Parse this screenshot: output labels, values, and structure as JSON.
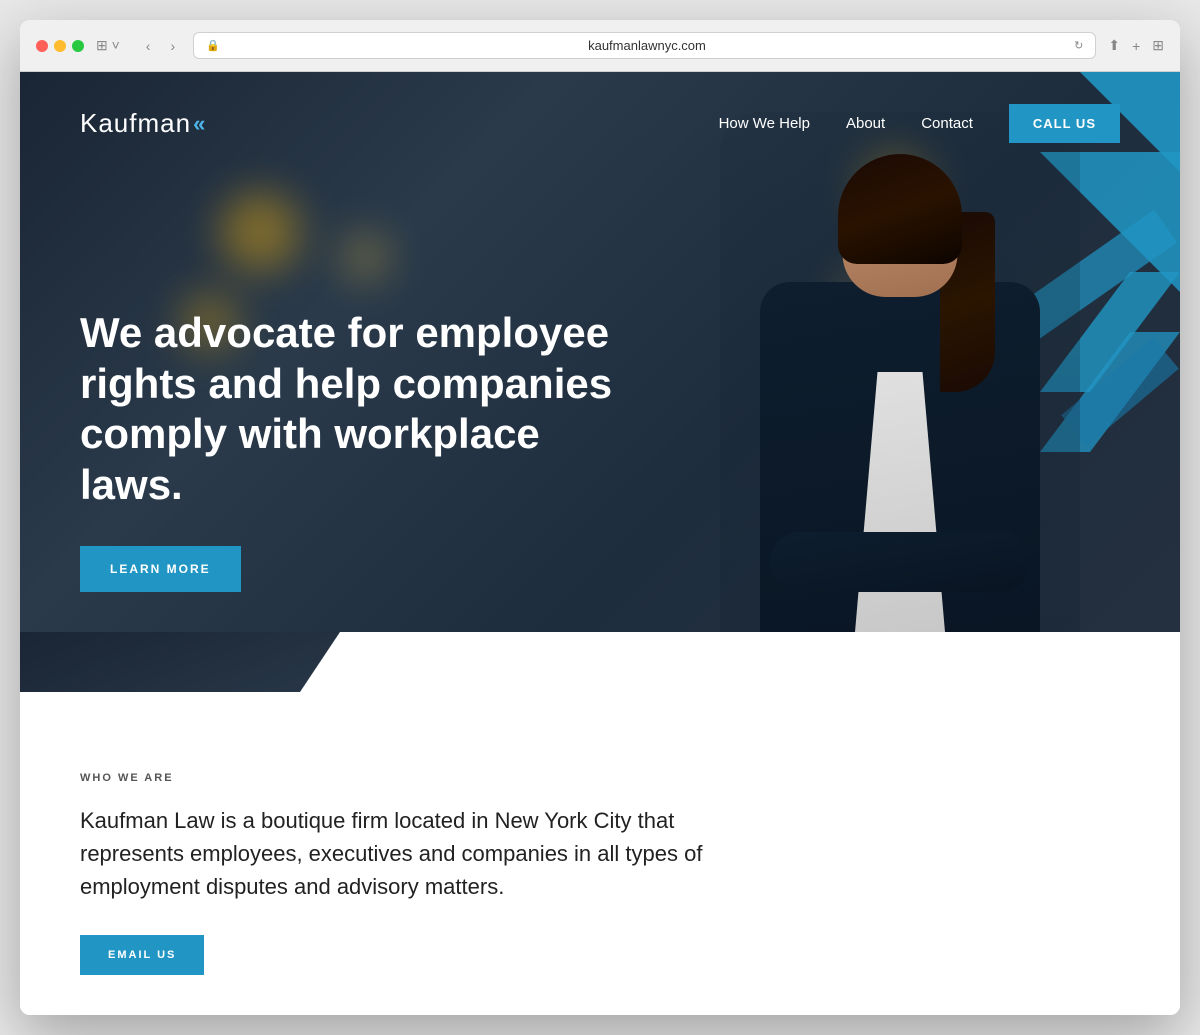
{
  "browser": {
    "url": "kaufmanlawnyc.com",
    "dots": [
      "red",
      "yellow",
      "green"
    ]
  },
  "nav": {
    "logo_text": "Kaufman",
    "links": [
      {
        "id": "how-we-help",
        "label": "How We Help"
      },
      {
        "id": "about",
        "label": "About"
      },
      {
        "id": "contact",
        "label": "Contact"
      }
    ],
    "cta_label": "CALL US"
  },
  "hero": {
    "headline": "We advocate for employee rights and help companies comply with workplace laws.",
    "cta_label": "LEARN MORE"
  },
  "about_section": {
    "section_label": "WHO WE ARE",
    "body_text": "Kaufman Law is a boutique firm located in New York City that represents employees, executives and companies in all types of employment disputes and advisory matters.",
    "cta_label": "EMAIL US"
  },
  "colors": {
    "blue": "#2196c4",
    "dark_bg": "#1a2535",
    "text_dark": "#222222",
    "text_label": "#555555"
  }
}
